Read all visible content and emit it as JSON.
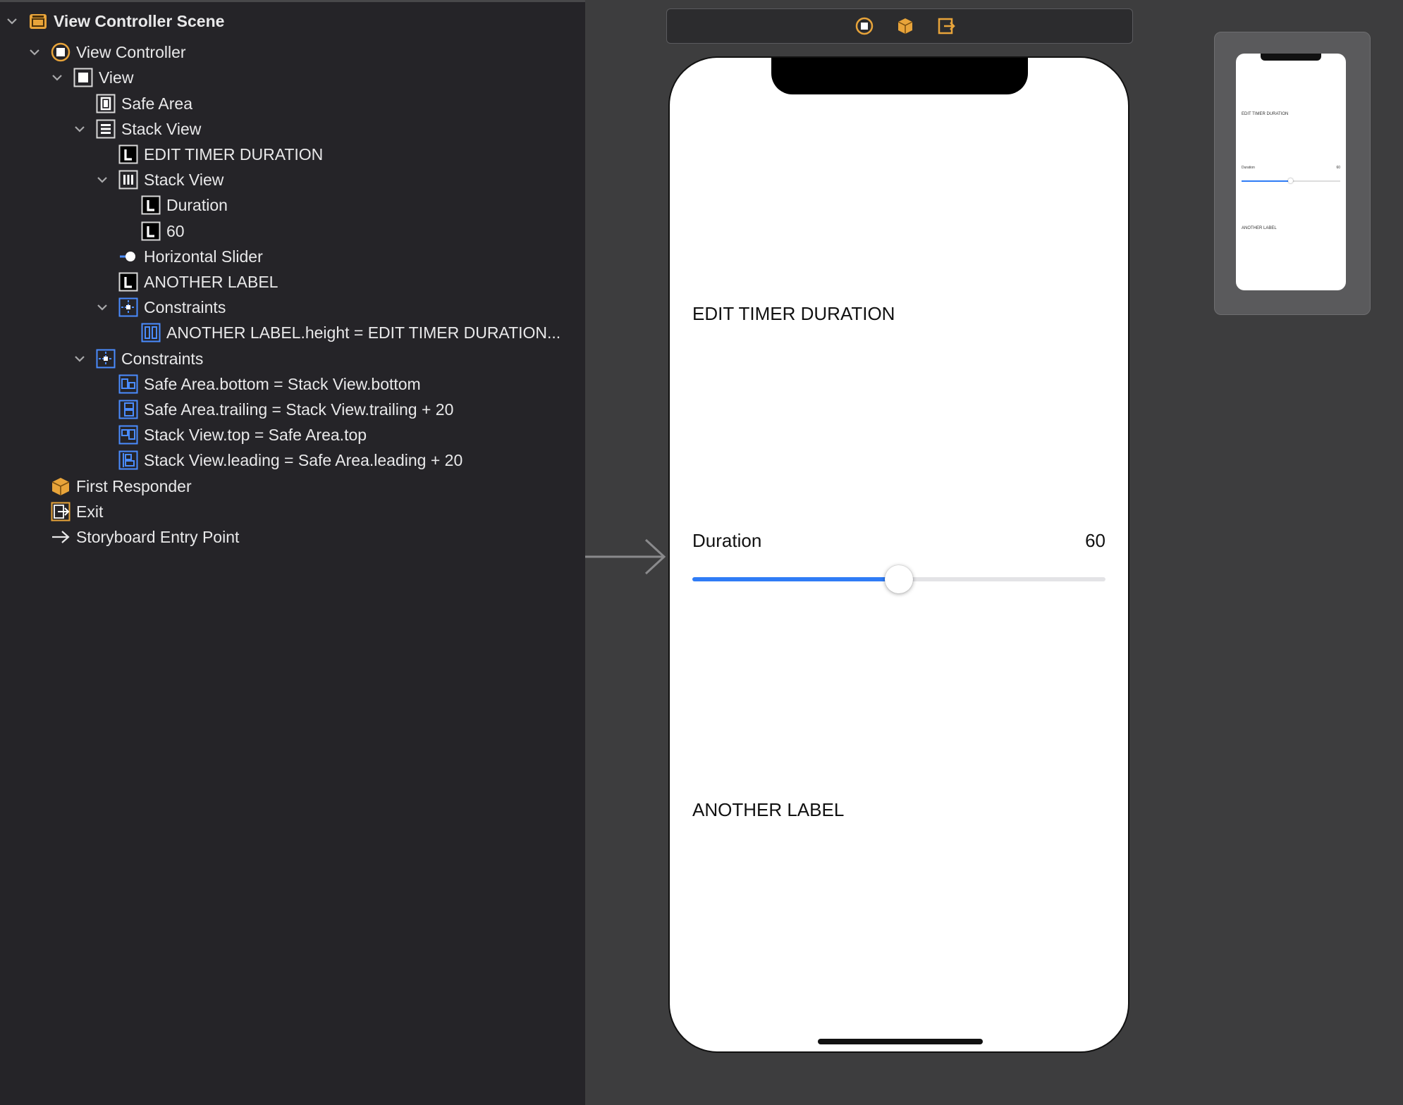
{
  "outline": {
    "items": [
      {
        "label": "View Controller Scene",
        "icon": "scene-icon",
        "expanded": true
      },
      {
        "label": "View Controller",
        "icon": "view-controller-icon",
        "expanded": true
      },
      {
        "label": "View",
        "icon": "view-icon",
        "expanded": true
      },
      {
        "label": "Safe Area",
        "icon": "safe-area-icon"
      },
      {
        "label": "Stack View",
        "icon": "vertical-stack-icon",
        "expanded": true
      },
      {
        "label": "EDIT TIMER DURATION",
        "icon": "label-icon"
      },
      {
        "label": "Stack View",
        "icon": "horizontal-stack-icon",
        "expanded": true
      },
      {
        "label": "Duration",
        "icon": "label-icon"
      },
      {
        "label": "60",
        "icon": "label-icon"
      },
      {
        "label": "Horizontal Slider",
        "icon": "slider-icon"
      },
      {
        "label": "ANOTHER LABEL",
        "icon": "label-icon"
      },
      {
        "label": "Constraints",
        "icon": "constraints-icon",
        "expanded": true
      },
      {
        "label": "ANOTHER LABEL.height = EDIT TIMER DURATION...",
        "icon": "height-constraint-icon"
      },
      {
        "label": "Constraints",
        "icon": "constraints-icon",
        "expanded": true
      },
      {
        "label": "Safe Area.bottom = Stack View.bottom",
        "icon": "bottom-constraint-icon"
      },
      {
        "label": "Safe Area.trailing = Stack View.trailing + 20",
        "icon": "trailing-constraint-icon"
      },
      {
        "label": "Stack View.top = Safe Area.top",
        "icon": "top-constraint-icon"
      },
      {
        "label": "Stack View.leading = Safe Area.leading + 20",
        "icon": "leading-constraint-icon"
      },
      {
        "label": "First Responder",
        "icon": "first-responder-icon"
      },
      {
        "label": "Exit",
        "icon": "exit-icon"
      },
      {
        "label": "Storyboard Entry Point",
        "icon": "entry-arrow-icon"
      }
    ]
  },
  "scene_dock": {
    "icons": [
      "view-controller-icon",
      "first-responder-icon",
      "exit-icon"
    ]
  },
  "device": {
    "title_label": "EDIT TIMER DURATION",
    "duration_label": "Duration",
    "value_label": "60",
    "slider_value_fraction": 0.5,
    "another_label": "ANOTHER LABEL"
  },
  "minimap": {
    "title_label": "EDIT TIMER DURATION",
    "duration_label": "Duration",
    "value_label": "60",
    "another_label": "ANOTHER LABEL"
  },
  "colors": {
    "accent": "#2f7cf6",
    "outline_bg": "#252428",
    "canvas_bg": "#3d3d3e",
    "icon_orange": "#e8a43a",
    "icon_blue": "#4a8cff"
  }
}
